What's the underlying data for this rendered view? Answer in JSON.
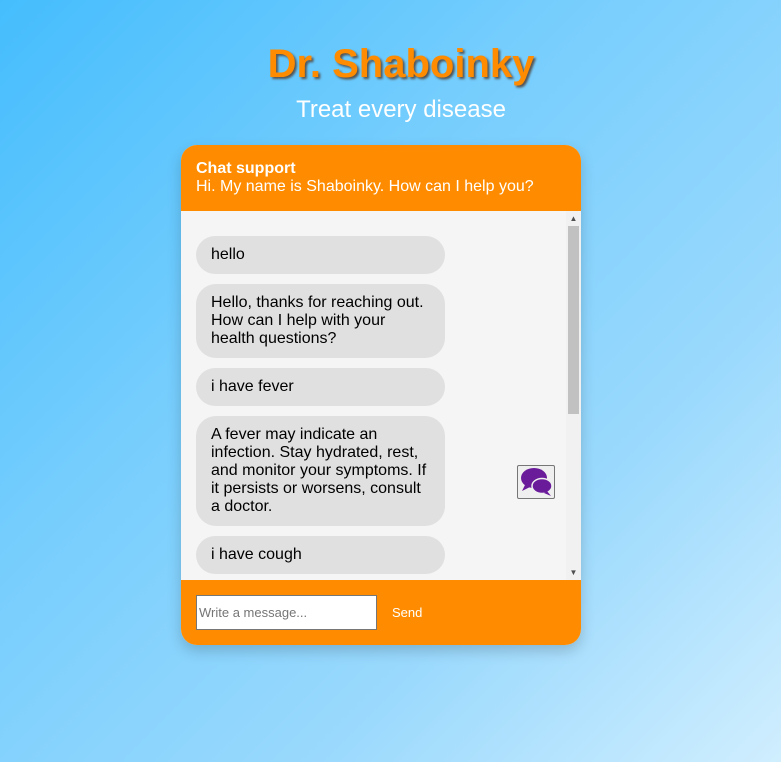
{
  "brand": {
    "title": "Dr. Shaboinky",
    "tagline": "Treat every disease"
  },
  "chat": {
    "header_title": "Chat support",
    "header_subtitle": "Hi. My name is Shaboinky. How can I help you?",
    "messages": [
      {
        "text": "hello"
      },
      {
        "text": "Hello, thanks for reaching out. How can I help with your health questions?"
      },
      {
        "text": "i have fever"
      },
      {
        "text": "A fever may indicate an infection. Stay hydrated, rest, and monitor your symptoms. If it persists or worsens, consult a doctor."
      },
      {
        "text": "i have cough"
      }
    ],
    "input_placeholder": "Write a message...",
    "input_value": "",
    "send_label": "Send",
    "toggle_icon": "speech-bubbles-icon"
  },
  "colors": {
    "accent": "#ff8c00",
    "bubble": "#e0e0e0",
    "icon": "#6a1b9a"
  }
}
